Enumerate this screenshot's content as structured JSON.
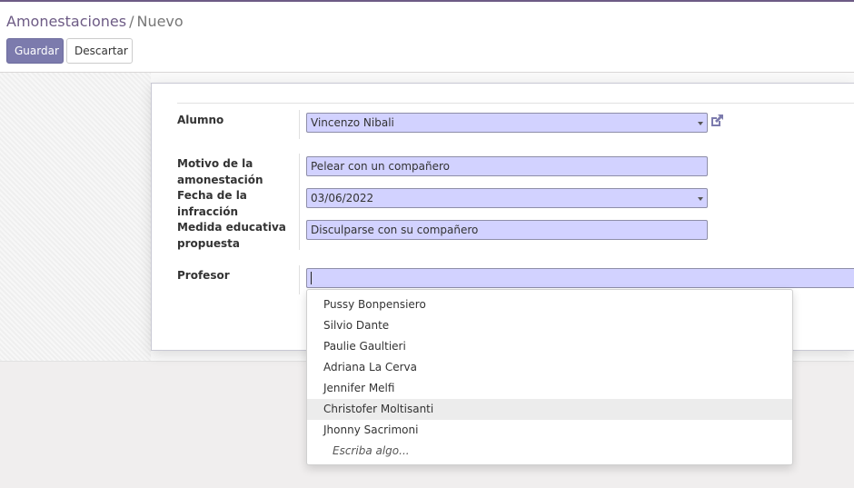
{
  "breadcrumb": {
    "parent": "Amonestaciones",
    "separator": "/",
    "current": "Nuevo"
  },
  "toolbar": {
    "save_label": "Guardar",
    "discard_label": "Descartar"
  },
  "form": {
    "alumno_label": "Alumno",
    "alumno_value": "Vincenzo Nibali",
    "motivo_label_line1": "Motivo de la",
    "motivo_label_line2": "amonestación",
    "motivo_value": "Pelear con un compañero",
    "fecha_label_line1": "Fecha de la",
    "fecha_label_line2": "infracción",
    "fecha_value": "03/06/2022",
    "medida_label_line1": "Medida educativa",
    "medida_label_line2": "propuesta",
    "medida_value": "Disculparse con su compañero",
    "profesor_label": "Profesor",
    "profesor_value": ""
  },
  "autocomplete": {
    "items": [
      "Pussy Bonpensiero",
      "Silvio Dante",
      "Paulie Gaultieri",
      "Adriana La Cerva",
      "Jennifer Melfi",
      "Christofer Moltisanti",
      "Jhonny Sacrimoni"
    ],
    "active_index": 5,
    "hint": "Escriba algo..."
  },
  "colors": {
    "brand": "#6d5b85",
    "primary_button": "#7c7bad",
    "required_field": "#d2d2ff"
  },
  "icons": {
    "external_link": "external-link-icon",
    "dropdown": "caret-down-icon"
  }
}
